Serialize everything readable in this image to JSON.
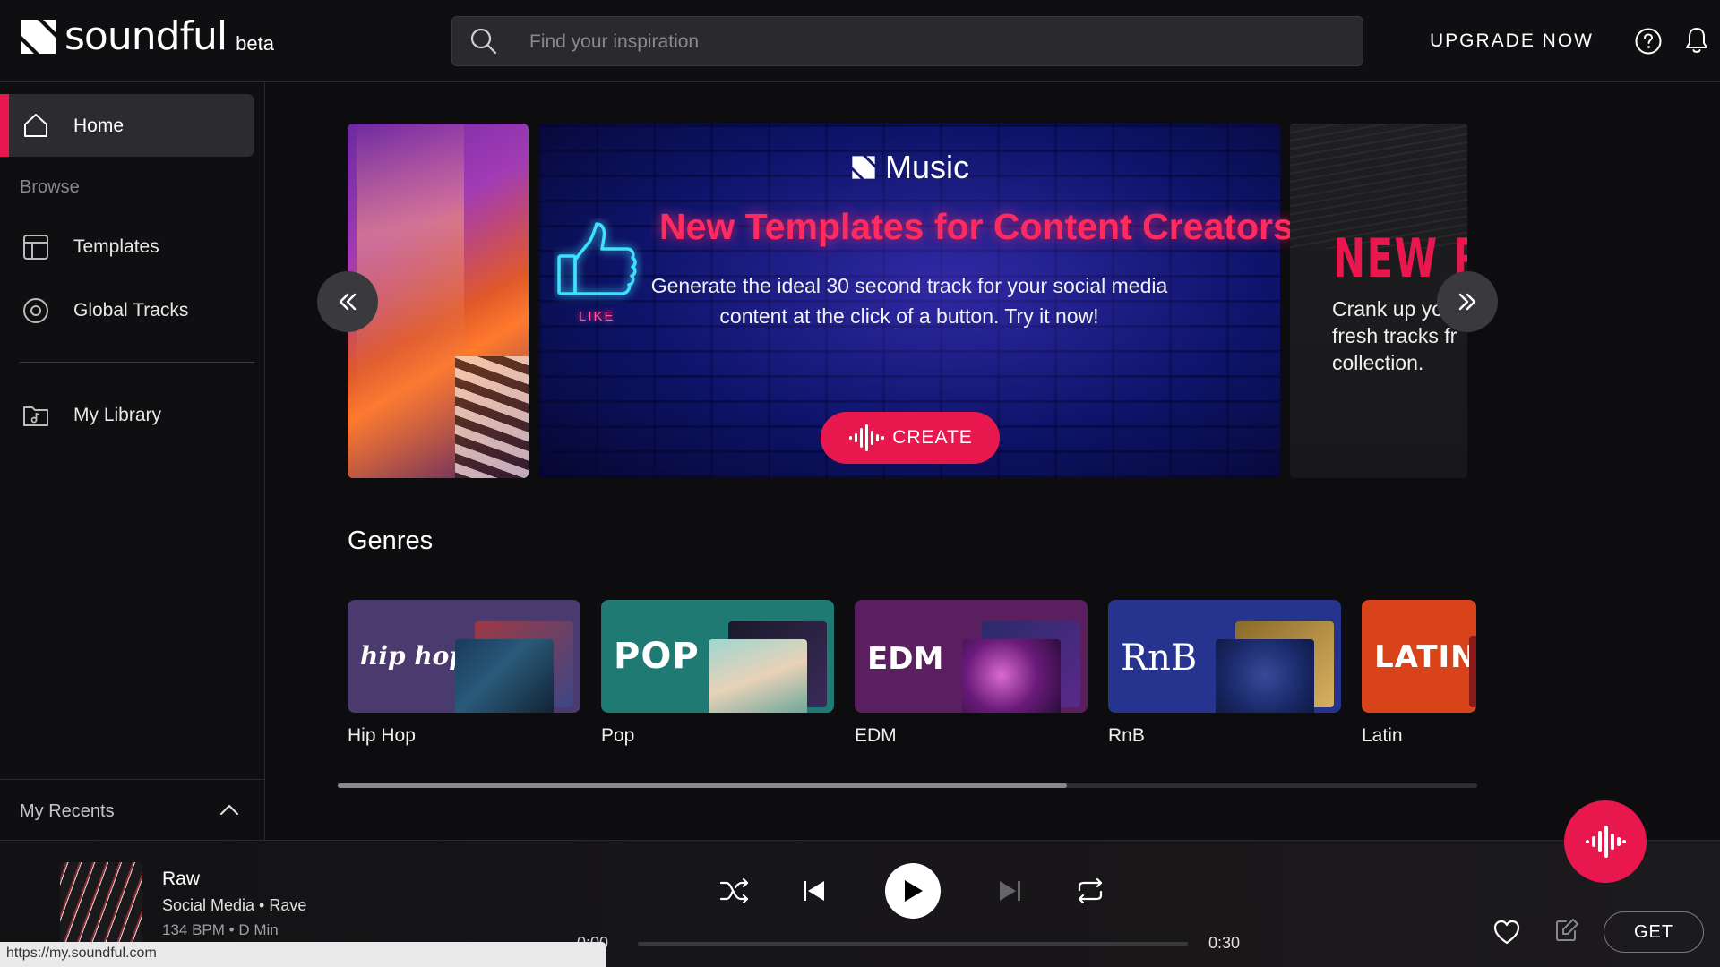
{
  "header": {
    "logo_word": "soundful",
    "logo_beta": "beta",
    "search_placeholder": "Find your inspiration",
    "upgrade_label": "UPGRADE NOW"
  },
  "sidebar": {
    "home": "Home",
    "browse": "Browse",
    "templates": "Templates",
    "global_tracks": "Global Tracks",
    "my_library": "My Library",
    "my_recents": "My Recents"
  },
  "banner": {
    "brand": "Music",
    "title": "New Templates for Content Creators",
    "description": "Generate the ideal 30 second track for your social media content at the click of a button. Try it now!",
    "like_text": "LIKE",
    "create_label": "CREATE",
    "next_title": "NEW RE",
    "next_desc_1": "Crank up yo",
    "next_desc_2": "fresh tracks fr",
    "next_desc_3": "collection."
  },
  "genres": {
    "heading": "Genres",
    "items": [
      {
        "label": "Hip Hop",
        "art_text": "hip hop",
        "color": "#4a3a6e"
      },
      {
        "label": "Pop",
        "art_text": "POP",
        "color": "#1e7a72"
      },
      {
        "label": "EDM",
        "art_text": "EDM",
        "color": "#5a1f5e"
      },
      {
        "label": "RnB",
        "art_text": "RnB",
        "color": "#27348f"
      },
      {
        "label": "Latin",
        "art_text": "LATIN",
        "color": "#d9431a"
      }
    ],
    "scroll_fraction": 0.64
  },
  "player": {
    "track_title": "Raw",
    "track_sub": "Social Media • Rave",
    "track_meta": "134 BPM • D Min",
    "time_start": "0:00",
    "time_end": "0:30",
    "get_label": "GET"
  },
  "status_url": "https://my.soundful.com",
  "colors": {
    "accent": "#e8184f",
    "background": "#0d0d0f",
    "panel": "#2c2c30"
  }
}
